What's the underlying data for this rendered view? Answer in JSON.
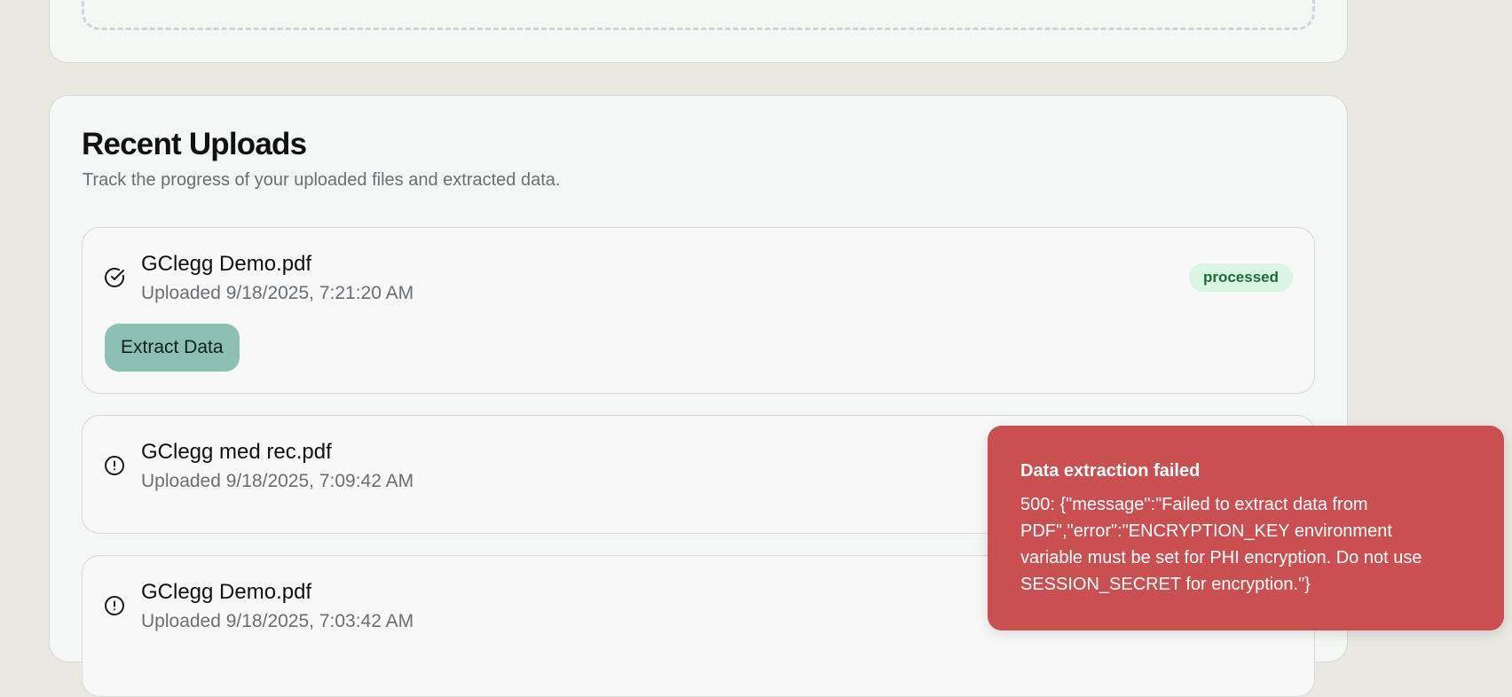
{
  "section": {
    "title": "Recent Uploads",
    "subtitle": "Track the progress of your uploaded files and extracted data."
  },
  "uploads": [
    {
      "name": "GClegg Demo.pdf",
      "uploaded": "Uploaded 9/18/2025, 7:21:20 AM",
      "status_icon": "check-circle-icon",
      "status": "processed",
      "action_label": "Extract Data"
    },
    {
      "name": "GClegg med rec.pdf",
      "uploaded": "Uploaded 9/18/2025, 7:09:42 AM",
      "status_icon": "alert-circle-icon"
    },
    {
      "name": "GClegg Demo.pdf",
      "uploaded": "Uploaded 9/18/2025, 7:03:42 AM",
      "status_icon": "alert-circle-icon"
    }
  ],
  "toast": {
    "title": "Data extraction failed",
    "message": "500: {\"message\":\"Failed to extract data from PDF\",\"error\":\"ENCRYPTION_KEY environment variable must be set for PHI encryption. Do not use SESSION_SECRET for encryption.\"}",
    "color": "#c94f50"
  },
  "colors": {
    "background": "#e9e9e1",
    "card": "#f5f7f6",
    "badge_bg": "#daf5e2",
    "badge_text": "#1d6b3b",
    "button": "#8ebfb5"
  }
}
